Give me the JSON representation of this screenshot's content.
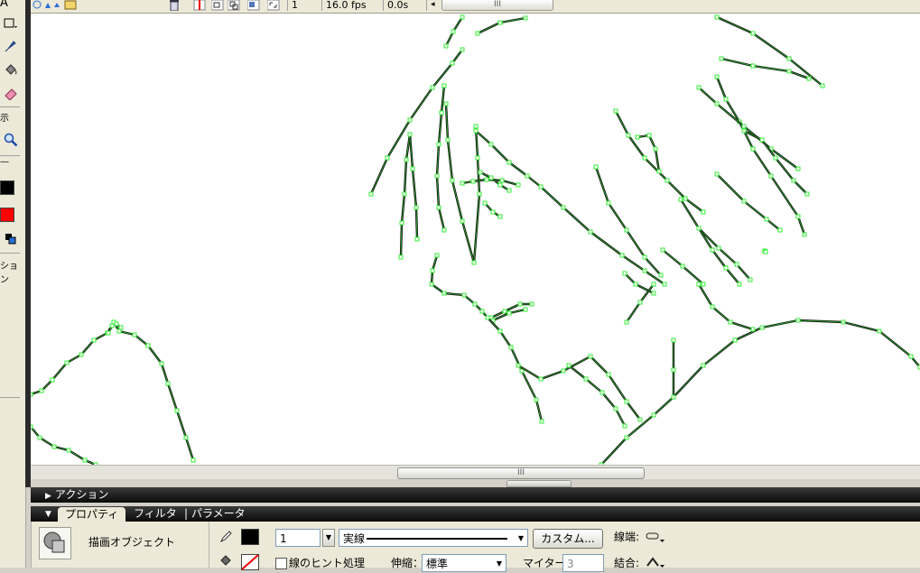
{
  "top_toolbar": {
    "frame_number": "1",
    "frame_rate": "16.0 fps",
    "elapsed_time": "0.0s",
    "scroll_grip": "III"
  },
  "tools": {
    "label_a": "A",
    "label_view": "示",
    "label_dash": "—",
    "label_options": "ション",
    "stroke_color": "#000000",
    "fill_color": "#ff0000"
  },
  "stage": {
    "background": "#ffffff",
    "stroke_color": "#111111",
    "path_highlight": "#2aa02a",
    "point_color": "#33ee33",
    "scroll_grip": "III"
  },
  "panels": {
    "actions_title": "アクション",
    "tabs": [
      {
        "label": "プロパティ",
        "active": true
      },
      {
        "label": "フィルタ",
        "active": false
      },
      {
        "label": "パラメータ",
        "active": false
      }
    ],
    "tab_separator": "|"
  },
  "properties": {
    "object_type": "描画オブジェクト",
    "stroke_height": "1",
    "stroke_style": "実線",
    "custom_button": "カスタム...",
    "cap_label": "線端:",
    "stroke_hinting": "線のヒント処理",
    "scale_label": "伸縮：",
    "scale_value": "標準",
    "miter_label": "マイター:",
    "miter_value": "3",
    "join_label": "結合:"
  }
}
